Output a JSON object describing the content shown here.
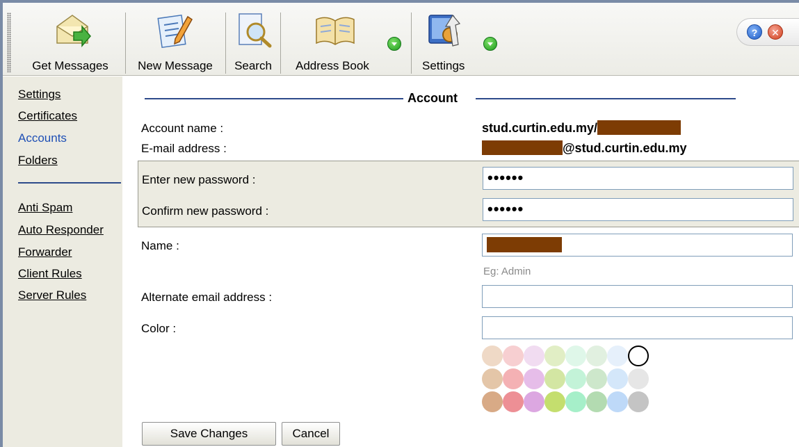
{
  "toolbar": {
    "get_messages": "Get Messages",
    "new_message": "New Message",
    "search": "Search",
    "address_book": "Address Book",
    "settings": "Settings",
    "help_glyph": "?",
    "close_glyph": "✕"
  },
  "sidebar": {
    "items": [
      {
        "label": "Settings"
      },
      {
        "label": "Certificates"
      },
      {
        "label": "Accounts"
      },
      {
        "label": "Folders"
      },
      {
        "label": "Anti Spam"
      },
      {
        "label": "Auto Responder"
      },
      {
        "label": "Forwarder"
      },
      {
        "label": "Client Rules"
      },
      {
        "label": "Server Rules"
      }
    ],
    "active": "Accounts"
  },
  "account": {
    "section_title": "Account",
    "account_name_label": "Account name :",
    "account_name_value": "stud.curtin.edu.my/",
    "email_label": "E-mail address :",
    "email_value": "@stud.curtin.edu.my",
    "new_password_label": "Enter new password :",
    "new_password_value": "••••••",
    "confirm_password_label": "Confirm new password :",
    "confirm_password_value": "••••••",
    "name_label": "Name :",
    "name_hint": "Eg: Admin",
    "alt_email_label": "Alternate email address :",
    "alt_email_value": "",
    "color_label": "Color :",
    "color_value": "",
    "palette": [
      [
        "#efd9c6",
        "#f7cfd1",
        "#f1dcf1",
        "#e1eec5",
        "#dff7e9",
        "#e1f0e0",
        "#e6f0fb",
        "#ffffff"
      ],
      [
        "#e4c6a8",
        "#f4b1b4",
        "#e6bde9",
        "#d3e6a3",
        "#c3f3d8",
        "#cde7cb",
        "#d4e7fa",
        "#e6e6e6"
      ],
      [
        "#d8aa86",
        "#ed8f95",
        "#dca7e1",
        "#c4de6e",
        "#a6efc9",
        "#b3dbb1",
        "#bed9f8",
        "#c4c4c4"
      ]
    ],
    "save_label": "Save Changes",
    "cancel_label": "Cancel"
  }
}
